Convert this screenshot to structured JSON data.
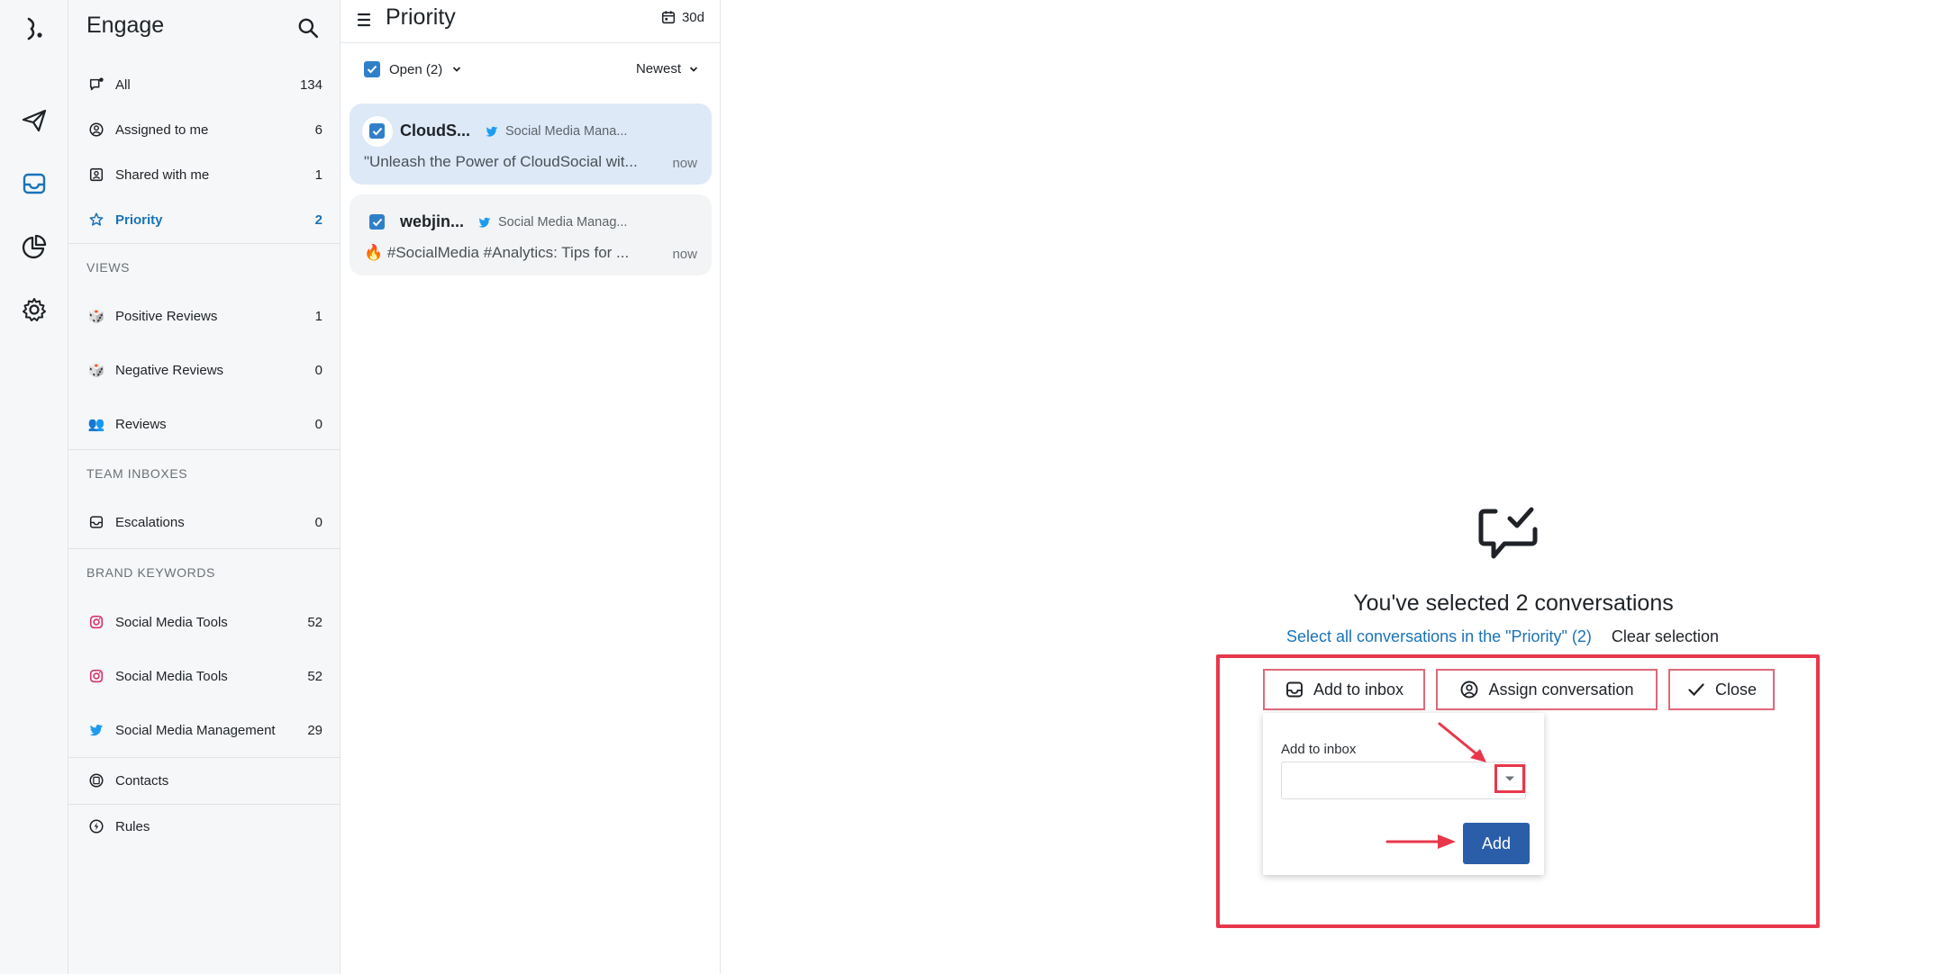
{
  "rail": {
    "icons": [
      "logo-icon",
      "send-icon",
      "inbox-icon",
      "analytics-icon",
      "gear-icon"
    ]
  },
  "sidebar": {
    "title": "Engage",
    "items": [
      {
        "label": "All",
        "count": "134",
        "icon": "chat-alert-icon"
      },
      {
        "label": "Assigned to me",
        "count": "6",
        "icon": "user-circle-icon"
      },
      {
        "label": "Shared with me",
        "count": "1",
        "icon": "shared-user-icon"
      },
      {
        "label": "Priority",
        "count": "2",
        "icon": "star-icon"
      }
    ],
    "views_heading": "VIEWS",
    "views": [
      {
        "label": "Positive Reviews",
        "count": "1",
        "icon": "dice-emoji"
      },
      {
        "label": "Negative Reviews",
        "count": "0",
        "icon": "dice-emoji"
      },
      {
        "label": "Reviews",
        "count": "0",
        "icon": "people-emoji"
      }
    ],
    "team_heading": "TEAM INBOXES",
    "team": [
      {
        "label": "Escalations",
        "count": "0",
        "icon": "inbox-icon"
      }
    ],
    "brand_heading": "BRAND KEYWORDS",
    "brand": [
      {
        "label": "Social Media Tools",
        "count": "52",
        "icon": "instagram-icon"
      },
      {
        "label": "Social Media Tools",
        "count": "52",
        "icon": "instagram-icon"
      },
      {
        "label": "Social Media Management",
        "count": "29",
        "icon": "twitter-icon"
      }
    ],
    "contacts": "Contacts",
    "rules": "Rules"
  },
  "list": {
    "title": "Priority",
    "range": "30d",
    "filter": "Open (2)",
    "sort": "Newest",
    "cards": [
      {
        "who": "CloudS...",
        "source": "Social Media Mana...",
        "snippet": "\"Unleash the Power of CloudSocial wit...",
        "time": "now"
      },
      {
        "who": "webjin...",
        "source": "Social Media Manag...",
        "snippet": "🔥 #SocialMedia #Analytics: Tips for ...",
        "time": "now"
      }
    ]
  },
  "main": {
    "selected_title": "You've selected 2 conversations",
    "select_all": "Select all conversations in the \"Priority\" (2)",
    "clear": "Clear selection",
    "actions": {
      "add_inbox": "Add to inbox",
      "assign": "Assign conversation",
      "close": "Close"
    },
    "popover": {
      "label": "Add to inbox",
      "select_value": "",
      "add": "Add"
    }
  },
  "colors": {
    "accent": "#1a73b8",
    "annotation_red": "#e8374b",
    "add_button": "#2b5ea9"
  }
}
